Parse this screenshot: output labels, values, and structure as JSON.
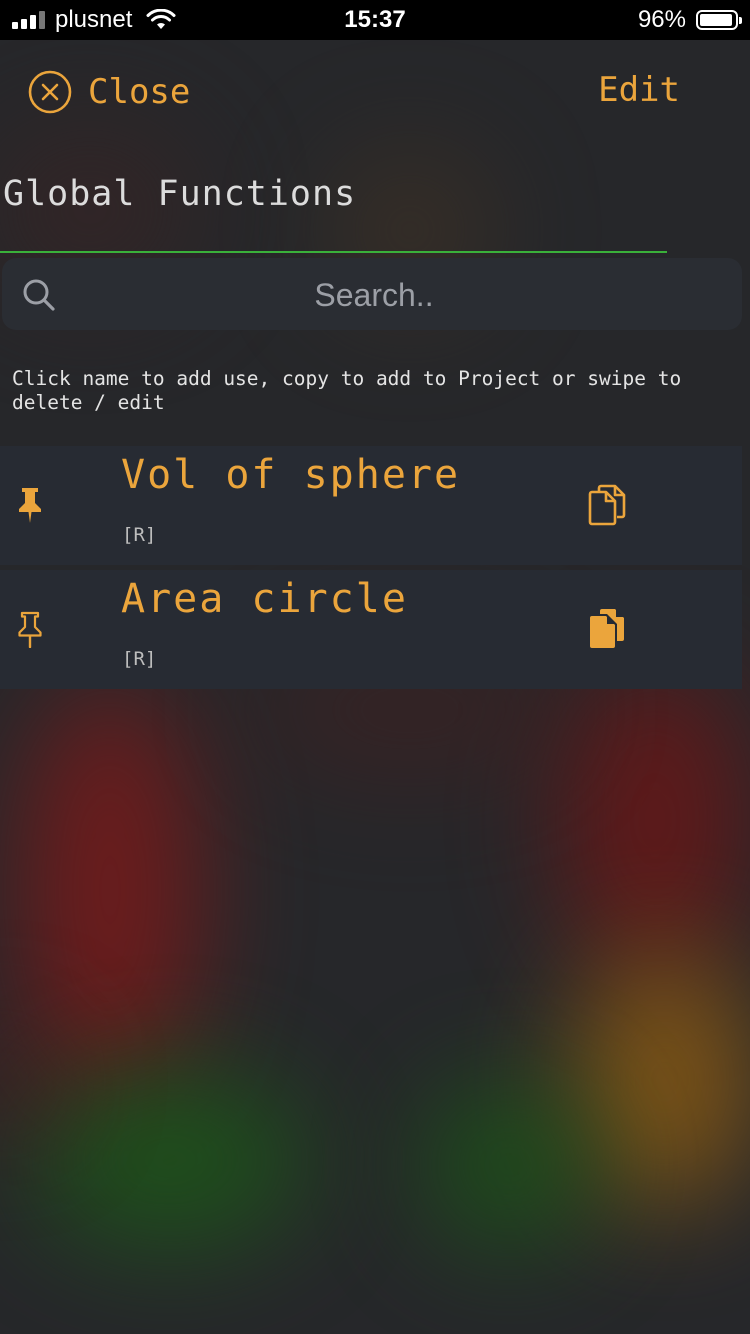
{
  "status_bar": {
    "carrier": "plusnet",
    "time": "15:37",
    "battery": "96%"
  },
  "header": {
    "close_label": "Close",
    "edit_label": "Edit"
  },
  "title": "Global Functions",
  "search": {
    "placeholder": "Search..",
    "value": ""
  },
  "hint": "Click name to add use, copy to add to Project or swipe to delete / edit",
  "functions": [
    {
      "name": "Vol of sphere",
      "tag": "[R]",
      "pinned": true,
      "pin_icon": "pin-filled-icon",
      "copy_icon": "copy-outline-icon"
    },
    {
      "name": "Area circle",
      "tag": "[R]",
      "pinned": false,
      "pin_icon": "pin-outline-icon",
      "copy_icon": "copy-filled-icon"
    }
  ],
  "colors": {
    "accent": "#eba53c",
    "underline": "#3ab03a",
    "row_bg": "#272b33"
  }
}
